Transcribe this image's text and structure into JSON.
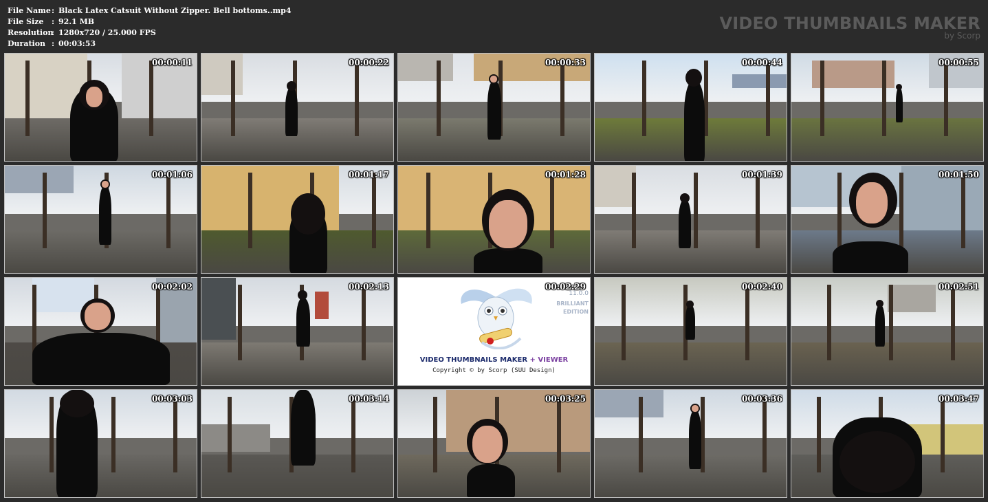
{
  "file_info": {
    "rows": [
      {
        "label": "File Name",
        "sep": ":",
        "value": "Black Latex Catsuit Without Zipper. Bell bottoms..mp4"
      },
      {
        "label": "File Size",
        "sep": ":",
        "value": "92.1 MB"
      },
      {
        "label": "Resolution",
        "sep": ":",
        "value": "1280x720 / 25.000 FPS"
      },
      {
        "label": "Duration",
        "sep": ":",
        "value": "00:03:53"
      }
    ]
  },
  "brand": {
    "title": "VIDEO THUMBNAILS MAKER",
    "subtitle": "by Scorp"
  },
  "thumbnails": [
    {
      "time": "00:00:11",
      "scene": "building-portrait"
    },
    {
      "time": "00:00:22",
      "scene": "street-walk-away"
    },
    {
      "time": "00:00:33",
      "scene": "park-path-toward"
    },
    {
      "time": "00:00:44",
      "scene": "park-walk-side"
    },
    {
      "time": "00:00:55",
      "scene": "park-far"
    },
    {
      "time": "00:01:06",
      "scene": "sidewalk-toward"
    },
    {
      "time": "00:01:17",
      "scene": "building-back"
    },
    {
      "time": "00:01:28",
      "scene": "building-portrait-smile"
    },
    {
      "time": "00:01:39",
      "scene": "street-walk-away"
    },
    {
      "time": "00:01:50",
      "scene": "glass-building-portrait"
    },
    {
      "time": "00:02:02",
      "scene": "couple-selfie"
    },
    {
      "time": "00:02:13",
      "scene": "plaza-walk"
    },
    {
      "time": "00:02:29",
      "scene": "logo"
    },
    {
      "time": "00:02:40",
      "scene": "park-stairs"
    },
    {
      "time": "00:02:51",
      "scene": "park-stairs-far"
    },
    {
      "time": "00:03:03",
      "scene": "road-back-close"
    },
    {
      "time": "00:03:14",
      "scene": "road-legs"
    },
    {
      "time": "00:03:25",
      "scene": "building-kiss"
    },
    {
      "time": "00:03:36",
      "scene": "sidewalk-toward"
    },
    {
      "time": "00:03:47",
      "scene": "hair-back"
    }
  ],
  "logo": {
    "title": "VIDEO THUMBNAILS MAKER",
    "plus": "+ VIEWER",
    "copyright": "Copyright © by Scorp (SUU Design)",
    "version": "11.0.0",
    "edition_line1": "BRILLIANT",
    "edition_line2": "EDITION"
  }
}
